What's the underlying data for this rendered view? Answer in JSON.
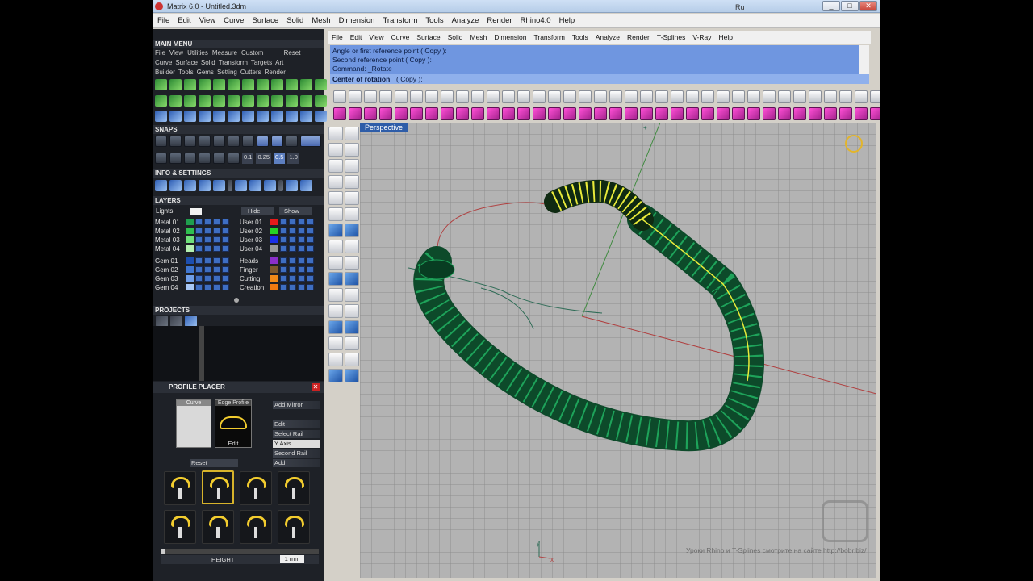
{
  "window": {
    "title": "Matrix 6.0 - Untitled.3dm",
    "lang": "Ru",
    "minimize": "_",
    "maximize": "□",
    "close": "✕"
  },
  "main_menu": [
    "File",
    "Edit",
    "View",
    "Curve",
    "Surface",
    "Solid",
    "Mesh",
    "Dimension",
    "Transform",
    "Tools",
    "Analyze",
    "Render",
    "Rhino4.0",
    "Help"
  ],
  "left_panel": {
    "main_menu_title": "MAIN MENU",
    "submenu_row1": [
      "File",
      "View",
      "Utilities",
      "Measure",
      "Custom",
      "Reset"
    ],
    "submenu_row2": [
      "Curve",
      "Surface",
      "Solid",
      "Transform",
      "Targets",
      "Art"
    ],
    "submenu_row3": [
      "Builder",
      "Tools",
      "Gems",
      "Setting",
      "Cutters",
      "Render"
    ],
    "snaps_title": "SNAPS",
    "snap_values": [
      "0.1",
      "0.25",
      "0.5",
      "1.0"
    ],
    "info_title": "INFO & SETTINGS",
    "layers_title": "LAYERS",
    "hide_label": "Hide",
    "show_label": "Show",
    "layers_left": [
      {
        "name": "Lights",
        "color": "#f2f2f2"
      },
      {
        "name": "Metal 01",
        "color": "#1f9e4d"
      },
      {
        "name": "Metal 02",
        "color": "#2fbf4f"
      },
      {
        "name": "Metal 03",
        "color": "#6fe07a"
      },
      {
        "name": "Metal 04",
        "color": "#b4f0b0"
      },
      {
        "name": "Gem 01",
        "color": "#1d4fb0"
      },
      {
        "name": "Gem 02",
        "color": "#3f76d0"
      },
      {
        "name": "Gem 03",
        "color": "#6f9ee8"
      },
      {
        "name": "Gem 04",
        "color": "#a9c8f5"
      }
    ],
    "layers_right": [
      {
        "name": "User 01",
        "color": "#e61a1a"
      },
      {
        "name": "User 02",
        "color": "#27d227"
      },
      {
        "name": "User 03",
        "color": "#1a2fe6"
      },
      {
        "name": "User 04",
        "color": "#9a9a9a"
      },
      {
        "name": "Heads",
        "color": "#8a2fc9"
      },
      {
        "name": "Finger",
        "color": "#7d5a2c"
      },
      {
        "name": "Cutting",
        "color": "#f08a18"
      },
      {
        "name": "Creation",
        "color": "#f07a10"
      }
    ],
    "projects_title": "PROJECTS",
    "profile_placer": {
      "title": "PROFILE PLACER",
      "curve_label": "Curve",
      "edge_profile_label": "Edge Profile",
      "edit_label": "Edit",
      "reset_label": "Reset",
      "buttons": [
        "Add Mirror",
        "Edit",
        "Select Rail",
        "Y Axis",
        "Second Rail",
        "Add"
      ],
      "height_label": "HEIGHT",
      "height_value": "1 mm"
    }
  },
  "right": {
    "menu": [
      "File",
      "Edit",
      "View",
      "Curve",
      "Surface",
      "Solid",
      "Mesh",
      "Dimension",
      "Transform",
      "Tools",
      "Analyze",
      "Render",
      "T-Splines",
      "V-Ray",
      "Help"
    ],
    "command_history": [
      "Angle or first reference point ( Copy ):",
      "Second reference point ( Copy ):",
      "Command: _Rotate"
    ],
    "command_prompt": "Center of rotation",
    "command_option": "( Copy ):",
    "viewport_label": "Perspective",
    "watermark": "Уроки Rhino и T-Splines смотрите на сайте http://bobr.biz/",
    "axis_x": "x",
    "axis_y": "y"
  }
}
